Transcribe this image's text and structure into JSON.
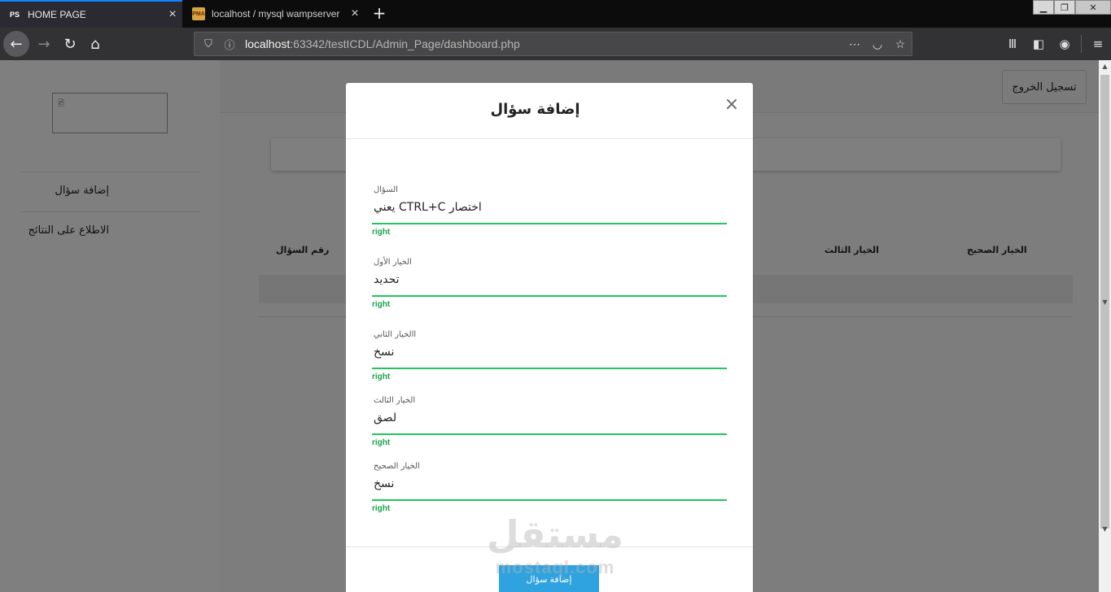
{
  "browser": {
    "tabs": [
      {
        "label": "HOME PAGE",
        "favicon": "PS"
      },
      {
        "label": "localhost / mysql wampserver",
        "favicon": "PMA"
      }
    ],
    "url_host": "localhost",
    "url_rest": ":63342/testICDL/Admin_Page/dashboard.php",
    "more_icon": "⋯"
  },
  "sidebar": {
    "items": [
      {
        "label": "إضافة سؤال"
      },
      {
        "label": "الاطلاع على النتائج"
      }
    ]
  },
  "header": {
    "logout_label": "تسجيل الخروج"
  },
  "table": {
    "columns": [
      "رقم السؤال",
      "الخيار الثالث",
      "الخيار الصحيح"
    ]
  },
  "modal": {
    "title": "إضافة سؤال",
    "fields": [
      {
        "label": "السؤال",
        "value": "يعني CTRL+C اختصار",
        "hint": "right"
      },
      {
        "label": "الخيار الأول",
        "value": "تحديد",
        "hint": "right"
      },
      {
        "label": "االخيار الثاني",
        "value": "نسخ",
        "hint": "right"
      },
      {
        "label": "الخيار الثالث",
        "value": "لصق",
        "hint": "right"
      },
      {
        "label": "الخيار الصحيح",
        "value": "نسخ",
        "hint": "right"
      }
    ],
    "submit_label": "إضافة سؤال"
  },
  "watermark": {
    "arabic": "مستقل",
    "latin": "mostaql.com"
  },
  "colors": {
    "accent_green": "#21c45d",
    "submit_blue": "#2fa3e0",
    "tab_highlight": "#0a84ff"
  }
}
